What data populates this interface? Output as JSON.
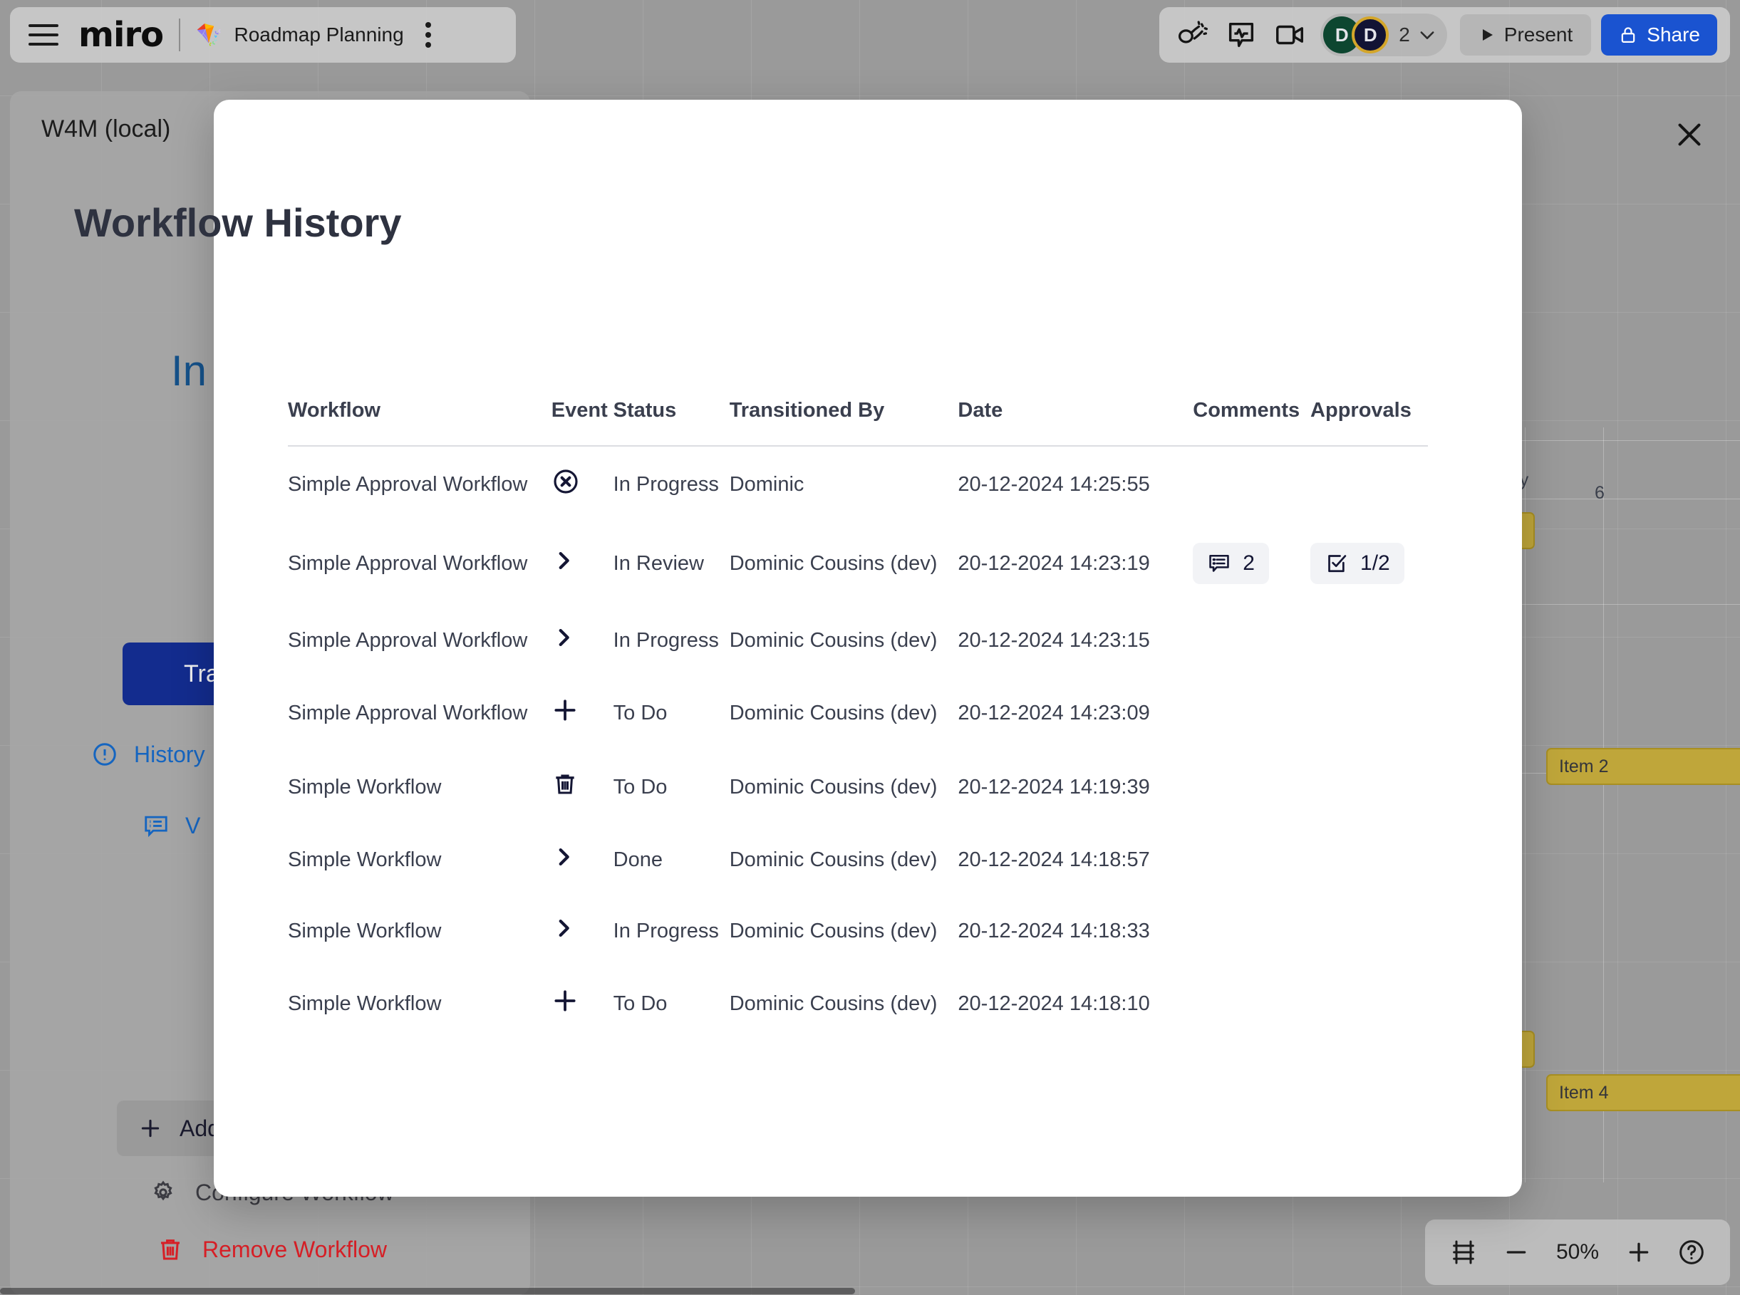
{
  "topbar": {
    "menu_icon": "hamburger-icon",
    "logo": "miro",
    "board_emoji": "🪁",
    "board_title": "Roadmap Planning",
    "kebab_icon": "more-options-icon",
    "icons": [
      "celebrate-icon",
      "reactions-icon",
      "video-call-icon"
    ],
    "avatars": [
      {
        "initial": "D",
        "color": "#0d4630"
      },
      {
        "initial": "D",
        "color": "#121334",
        "ring": "#d4a62a"
      }
    ],
    "participant_count": "2",
    "chevron_icon": "chevron-down-icon",
    "present_label": "Present",
    "present_icon": "play-icon",
    "share_label": "Share",
    "share_icon": "lock-icon",
    "share_color": "#1a53d0"
  },
  "left_panel": {
    "title": "W4M (local)",
    "status_text": "In",
    "transition_label": "Transition",
    "transition_color": "#132c8e",
    "history_label": "History",
    "history_icon": "info-circle-icon",
    "view_comments_label": "V",
    "view_comments_icon": "comment-list-icon",
    "add_label": "Add",
    "add_icon": "plus-icon",
    "configure_label": "Configure Workflow",
    "configure_icon": "gear-icon",
    "remove_label": "Remove Workflow",
    "remove_icon": "trash-icon",
    "remove_color": "#d61f26",
    "link_color": "#1565c0"
  },
  "timeline": {
    "month_label": "uary",
    "day_label": "6",
    "bars": [
      {
        "label": "Item 2"
      },
      {
        "label": "Item 4"
      }
    ]
  },
  "zoombar": {
    "fit_icon": "fit-to-screen-icon",
    "minus_icon": "minus-icon",
    "zoom_level": "50%",
    "plus_icon": "plus-icon",
    "help_icon": "help-circle-icon"
  },
  "modal": {
    "close_icon": "close-icon",
    "title": "Workflow History",
    "table": {
      "columns": [
        "Workflow",
        "Event",
        "Status",
        "Transitioned By",
        "Date",
        "Comments",
        "Approvals"
      ],
      "rows": [
        {
          "workflow": "Simple Approval Workflow",
          "event_icon": "circle-x-icon",
          "status": "In Progress",
          "transitioned_by": "Dominic",
          "date": "20-12-2024 14:25:55",
          "comments": "",
          "approvals": ""
        },
        {
          "workflow": "Simple Approval Workflow",
          "event_icon": "chevron-right-icon",
          "status": "In Review",
          "transitioned_by": "Dominic Cousins (dev)",
          "date": "20-12-2024 14:23:19",
          "comments": "2",
          "approvals": "1/2"
        },
        {
          "workflow": "Simple Approval Workflow",
          "event_icon": "chevron-right-icon",
          "status": "In Progress",
          "transitioned_by": "Dominic Cousins (dev)",
          "date": "20-12-2024 14:23:15",
          "comments": "",
          "approvals": ""
        },
        {
          "workflow": "Simple Approval Workflow",
          "event_icon": "plus-icon",
          "status": "To Do",
          "transitioned_by": "Dominic Cousins (dev)",
          "date": "20-12-2024 14:23:09",
          "comments": "",
          "approvals": ""
        },
        {
          "workflow": "Simple Workflow",
          "event_icon": "trash-icon",
          "status": "To Do",
          "transitioned_by": "Dominic Cousins (dev)",
          "date": "20-12-2024 14:19:39",
          "comments": "",
          "approvals": ""
        },
        {
          "workflow": "Simple Workflow",
          "event_icon": "chevron-right-icon",
          "status": "Done",
          "transitioned_by": "Dominic Cousins (dev)",
          "date": "20-12-2024 14:18:57",
          "comments": "",
          "approvals": ""
        },
        {
          "workflow": "Simple Workflow",
          "event_icon": "chevron-right-icon",
          "status": "In Progress",
          "transitioned_by": "Dominic Cousins (dev)",
          "date": "20-12-2024 14:18:33",
          "comments": "",
          "approvals": ""
        },
        {
          "workflow": "Simple Workflow",
          "event_icon": "plus-icon",
          "status": "To Do",
          "transitioned_by": "Dominic Cousins (dev)",
          "date": "20-12-2024 14:18:10",
          "comments": "",
          "approvals": ""
        }
      ]
    }
  }
}
